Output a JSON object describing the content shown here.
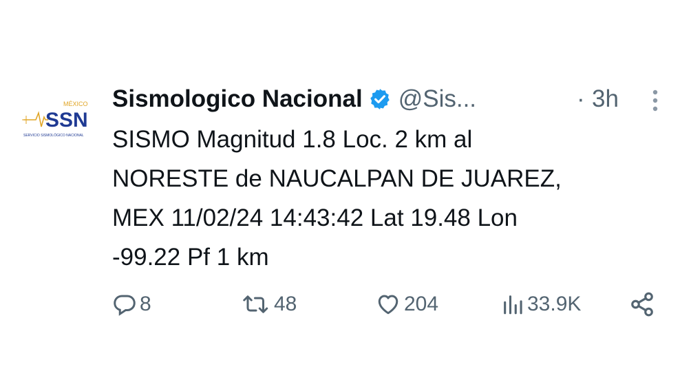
{
  "tweet": {
    "avatar": {
      "icon": "ssn-logo",
      "logo_top": "MÉXICO",
      "logo_main": "SSN",
      "logo_bottom": "SERVICIO SISMOLÓGICO NACIONAL"
    },
    "display_name": "Sismologico Nacional",
    "verified_icon": "verified-badge-icon",
    "handle": "@Sis...",
    "separator": "·",
    "time": "3h",
    "more_icon": "more-vertical-icon",
    "text": "SISMO Magnitud 1.8 Loc. 2 km al\nNORESTE de NAUCALPAN DE JUAREZ,\nMEX 11/02/24 14:43:42 Lat 19.48 Lon\n-99.22 Pf 1 km"
  },
  "actions": {
    "reply": {
      "icon": "reply-icon",
      "count": "8"
    },
    "retweet": {
      "icon": "retweet-icon",
      "count": "48"
    },
    "like": {
      "icon": "heart-icon",
      "count": "204"
    },
    "views": {
      "icon": "views-icon",
      "count": "33.9K"
    },
    "share": {
      "icon": "share-icon"
    }
  },
  "colors": {
    "text": "#0f1419",
    "muted": "#536471",
    "verified": "#1d9bf0",
    "logo_blue": "#1f3a93",
    "logo_gold": "#e0a526"
  }
}
